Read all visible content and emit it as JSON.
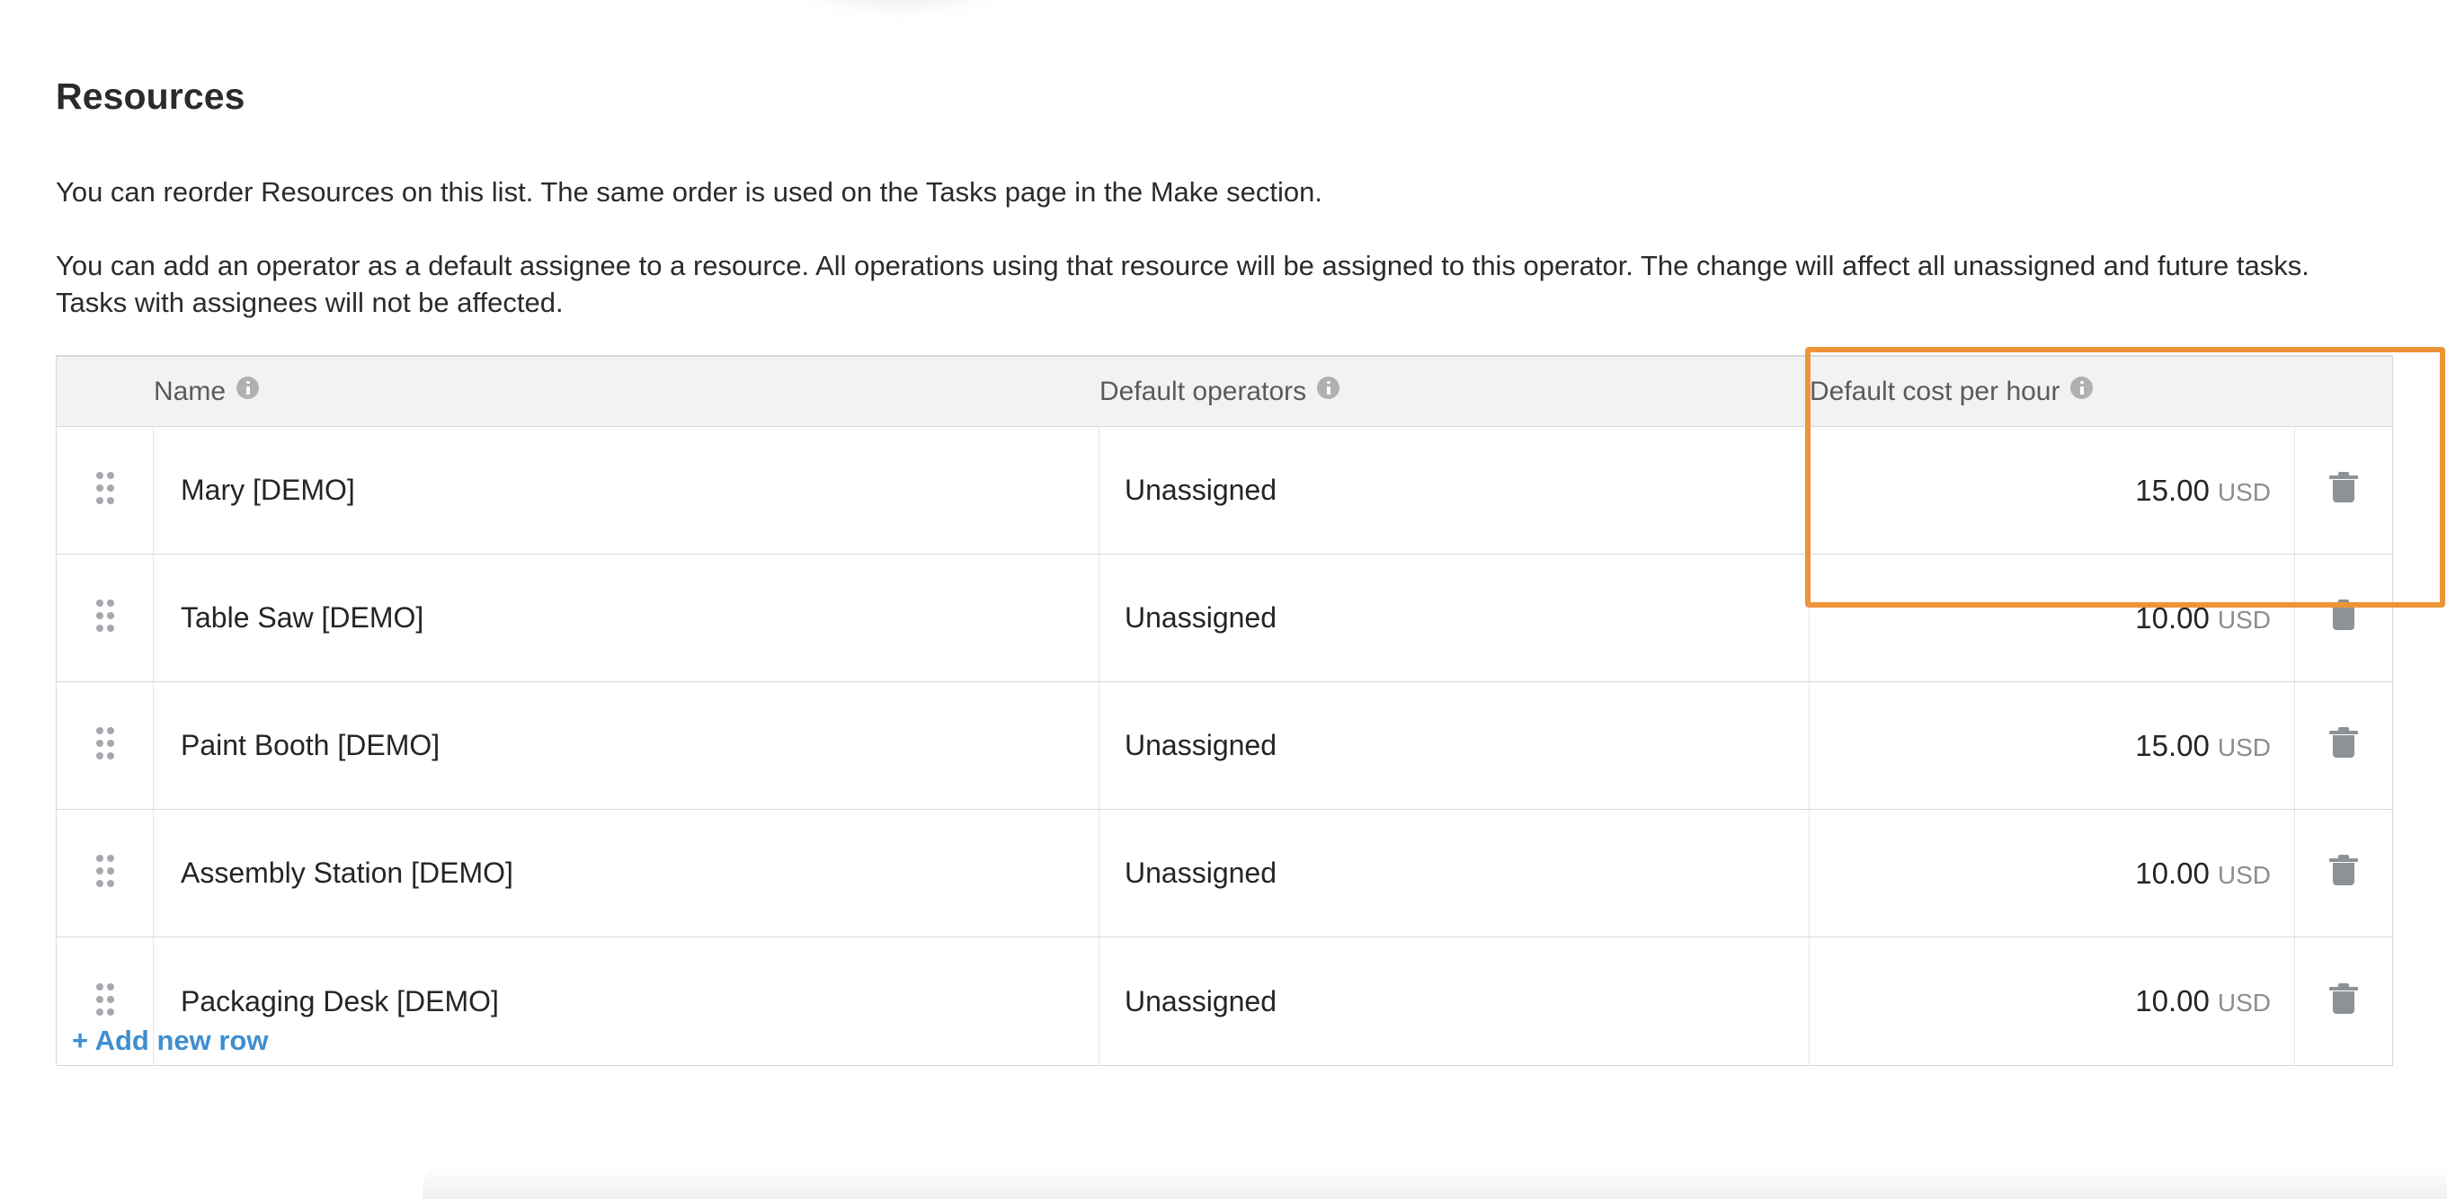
{
  "section": {
    "title": "Resources",
    "description_1": "You can reorder Resources on this list. The same order is used on the Tasks page in the Make section.",
    "description_2": "You can add an operator as a default assignee to a resource. All operations using that resource will be assigned to this operator. The change will affect all unassigned and future tasks. Tasks with assignees will not be affected."
  },
  "table": {
    "headers": {
      "name": "Name",
      "default_operators": "Default operators",
      "default_cost_per_hour": "Default cost per hour"
    },
    "rows": [
      {
        "name": "Mary [DEMO]",
        "default_operator": "Unassigned",
        "cost": "15.00",
        "currency": "USD"
      },
      {
        "name": "Table Saw [DEMO]",
        "default_operator": "Unassigned",
        "cost": "10.00",
        "currency": "USD"
      },
      {
        "name": "Paint Booth [DEMO]",
        "default_operator": "Unassigned",
        "cost": "15.00",
        "currency": "USD"
      },
      {
        "name": "Assembly Station [DEMO]",
        "default_operator": "Unassigned",
        "cost": "10.00",
        "currency": "USD"
      },
      {
        "name": "Packaging Desk [DEMO]",
        "default_operator": "Unassigned",
        "cost": "10.00",
        "currency": "USD"
      }
    ]
  },
  "actions": {
    "add_new_row": "+ Add new row"
  },
  "colors": {
    "highlight": "#ed9439",
    "link": "#3f8ed0",
    "header_bg": "#f2f2f2",
    "border": "#d6d8dc",
    "muted_text": "#8a8d91"
  }
}
